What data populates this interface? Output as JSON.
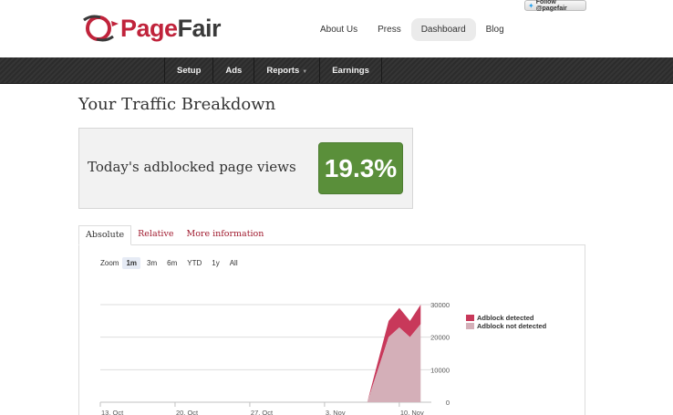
{
  "brand": {
    "name_part1": "Page",
    "name_part2": "Fair"
  },
  "twitter": {
    "label": "Follow @pagefair"
  },
  "top_nav": [
    {
      "label": "About Us",
      "active": false
    },
    {
      "label": "Press",
      "active": false
    },
    {
      "label": "Dashboard",
      "active": true
    },
    {
      "label": "Blog",
      "active": false
    }
  ],
  "sub_nav": [
    {
      "label": "Setup"
    },
    {
      "label": "Ads"
    },
    {
      "label": "Reports"
    },
    {
      "label": "Earnings"
    }
  ],
  "page_title": "Your Traffic Breakdown",
  "stat": {
    "label": "Today's adblocked page views",
    "value": "19.3%"
  },
  "tabs": [
    {
      "label": "Absolute",
      "active": true
    },
    {
      "label": "Relative",
      "active": false
    },
    {
      "label": "More information",
      "active": false
    }
  ],
  "zoom": {
    "label": "Zoom",
    "options": [
      "1m",
      "3m",
      "6m",
      "YTD",
      "1y",
      "All"
    ],
    "active": "1m"
  },
  "colors": {
    "brand_red": "#c0233b",
    "stat_green": "#5a8f3a",
    "series_detected": "#c8385a",
    "series_not_detected": "#d4afb8"
  },
  "chart_data": {
    "type": "area",
    "x": [
      "13. Oct",
      "20. Oct",
      "27. Oct",
      "3. Nov",
      "10. Nov"
    ],
    "x_points": [
      "13. Oct",
      "20. Oct",
      "27. Oct",
      "3. Nov",
      "7. Nov",
      "9. Nov",
      "10. Nov",
      "11. Nov",
      "12. Nov"
    ],
    "series": [
      {
        "name": "Adblock not detected",
        "values": [
          0,
          0,
          0,
          0,
          0,
          20000,
          23000,
          20000,
          24000
        ]
      },
      {
        "name": "Adblock detected",
        "values": [
          0,
          0,
          0,
          0,
          0,
          5000,
          6000,
          5000,
          6000
        ]
      }
    ],
    "stacked": true,
    "y_ticks": [
      0,
      10000,
      20000,
      30000
    ],
    "ylim": [
      0,
      30000
    ],
    "y_axis_side": "right",
    "legend_position": "right",
    "grid": true
  }
}
